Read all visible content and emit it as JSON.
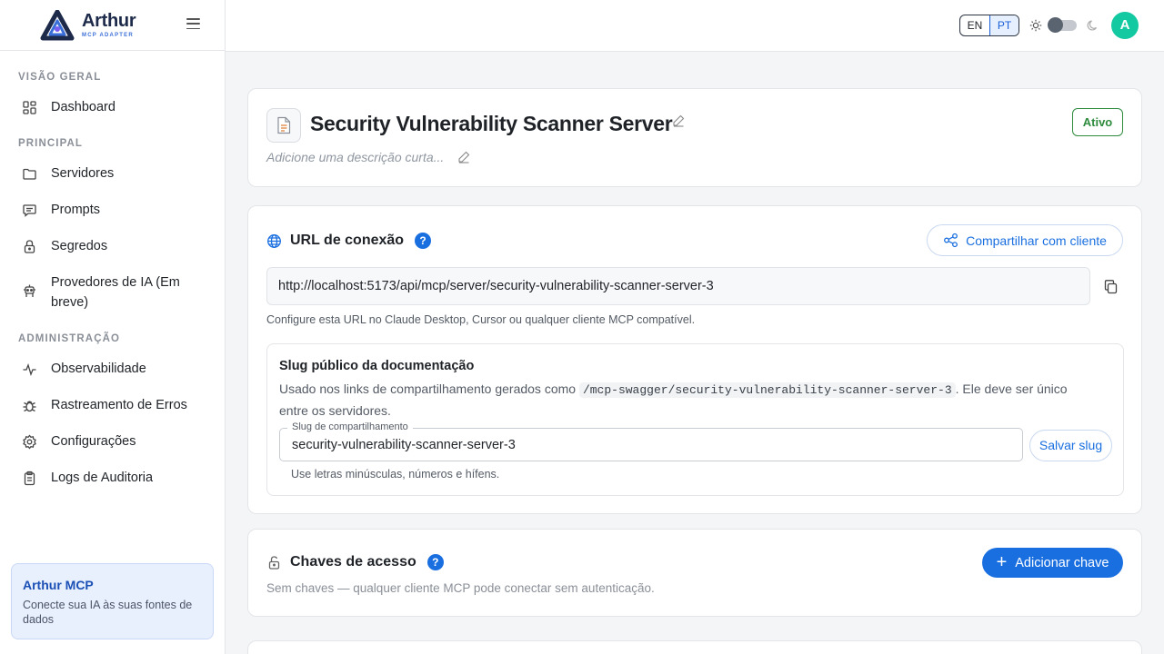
{
  "brand": {
    "name": "Arthur",
    "subtitle": "MCP ADAPTER"
  },
  "sidebar": {
    "sections": [
      {
        "title": "VISÃO GERAL"
      },
      {
        "title": "PRINCIPAL"
      },
      {
        "title": "ADMINISTRAÇÃO"
      }
    ],
    "items": [
      {
        "label": "Dashboard",
        "icon": "dashboard-icon"
      },
      {
        "label": "Servidores",
        "icon": "folder-icon"
      },
      {
        "label": "Prompts",
        "icon": "message-icon"
      },
      {
        "label": "Segredos",
        "icon": "lock-icon"
      },
      {
        "label": "Provedores de IA (Em breve)",
        "icon": "robot-icon"
      },
      {
        "label": "Observabilidade",
        "icon": "pulse-icon"
      },
      {
        "label": "Rastreamento de Erros",
        "icon": "bug-icon"
      },
      {
        "label": "Configurações",
        "icon": "gear-icon"
      },
      {
        "label": "Logs de Auditoria",
        "icon": "clipboard-icon"
      }
    ],
    "promo": {
      "title": "Arthur MCP",
      "text": "Conecte sua IA às suas fontes de dados"
    }
  },
  "topbar": {
    "lang_en": "EN",
    "lang_pt": "PT",
    "selected_lang": "PT",
    "avatar_initial": "A",
    "theme": "light"
  },
  "server": {
    "title": "Security Vulnerability Scanner Server",
    "description_placeholder": "Adicione uma descrição curta...",
    "status": "Ativo"
  },
  "connection": {
    "title": "URL de conexão",
    "help": "?",
    "share_label": "Compartilhar com cliente",
    "url": "http://localhost:5173/api/mcp/server/security-vulnerability-scanner-server-3",
    "help_text": "Configure esta URL no Claude Desktop, Cursor ou qualquer cliente MCP compatível.",
    "slug": {
      "title": "Slug público da documentação",
      "desc_before": "Usado nos links de compartilhamento gerados como ",
      "desc_code": "/mcp-swagger/security-vulnerability-scanner-server-3",
      "desc_after": ". Ele deve ser único entre os servidores.",
      "field_label": "Slug de compartilhamento",
      "field_value": "security-vulnerability-scanner-server-3",
      "save_label": "Salvar slug",
      "hint": "Use letras minúsculas, números e hífens."
    }
  },
  "keys": {
    "title": "Chaves de acesso",
    "help": "?",
    "add_label": "Adicionar chave",
    "empty_text": "Sem chaves — qualquer cliente MCP pode conectar sem autenticação."
  },
  "colors": {
    "primary": "#1a6fe0",
    "active": "#2e8b3e",
    "avatar": "#13c9a1"
  }
}
